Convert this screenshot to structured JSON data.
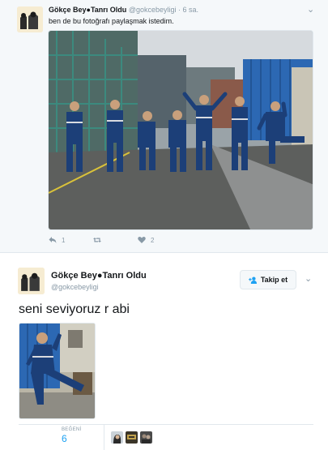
{
  "parent_tweet": {
    "name": "Gökçe Bey●Tanrı Oldu",
    "handle": "@gokcebeyligi",
    "separator": "·",
    "time": "6 sa.",
    "text": "ben de bu fotoğrafı paylaşmak istedim.",
    "actions": {
      "reply_count": "1",
      "retweet_count": "",
      "like_count": "2"
    }
  },
  "main_tweet": {
    "name": "Gökçe Bey●Tanrı Oldu",
    "handle": "@gokcebeyligi",
    "follow_label": "Takip et",
    "text": "seni seviyoruz r abi",
    "stats": {
      "likes_label": "BEĞENİ",
      "likes_value": "6"
    }
  },
  "icons": {
    "reply": "reply-icon",
    "retweet": "retweet-icon",
    "like": "heart-icon",
    "follow": "add-user-icon",
    "menu": "chevron-down-icon"
  },
  "colors": {
    "accent": "#1da1f2",
    "muted": "#8899a6",
    "border": "#e1e8ed",
    "thread_bg": "#f5f8fa"
  }
}
